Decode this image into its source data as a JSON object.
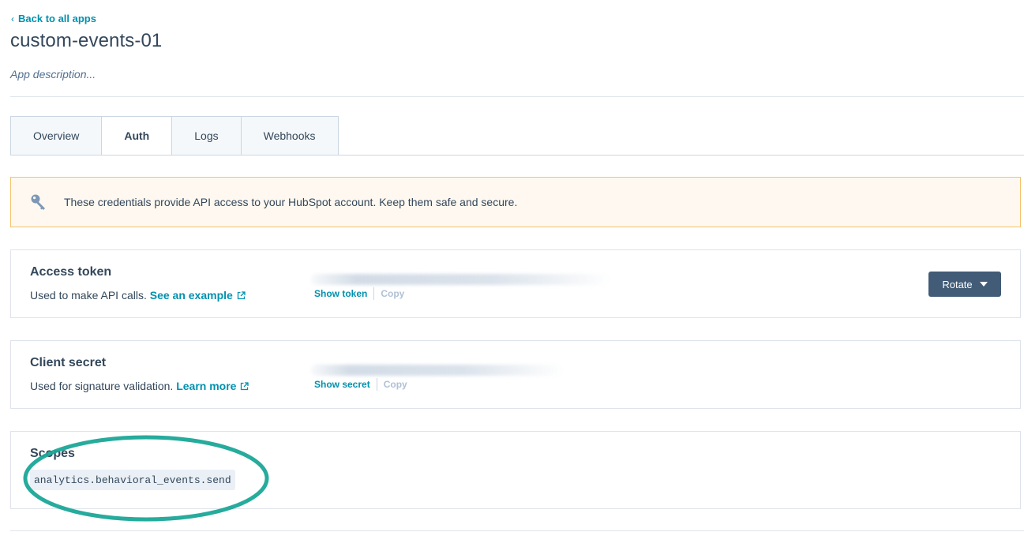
{
  "nav": {
    "back_label": "Back to all apps"
  },
  "app": {
    "title": "custom-events-01",
    "description": "App description..."
  },
  "tabs": [
    {
      "label": "Overview",
      "active": false
    },
    {
      "label": "Auth",
      "active": true
    },
    {
      "label": "Logs",
      "active": false
    },
    {
      "label": "Webhooks",
      "active": false
    }
  ],
  "alert": {
    "icon": "key-icon",
    "message": "These credentials provide API access to your HubSpot account. Keep them safe and secure."
  },
  "access_token": {
    "title": "Access token",
    "description": "Used to make API calls.",
    "link_label": "See an example",
    "show_label": "Show token",
    "copy_label": "Copy",
    "rotate_label": "Rotate"
  },
  "client_secret": {
    "title": "Client secret",
    "description": "Used for signature validation.",
    "link_label": "Learn more",
    "show_label": "Show secret",
    "copy_label": "Copy"
  },
  "scopes": {
    "title": "Scopes",
    "items": [
      "analytics.behavioral_events.send"
    ]
  },
  "colors": {
    "link": "#0091ae",
    "text": "#33475b",
    "button": "#425b76",
    "alert_bg": "#fef8f0",
    "alert_border": "#f5c26b",
    "highlight_ring": "#1aa797"
  }
}
